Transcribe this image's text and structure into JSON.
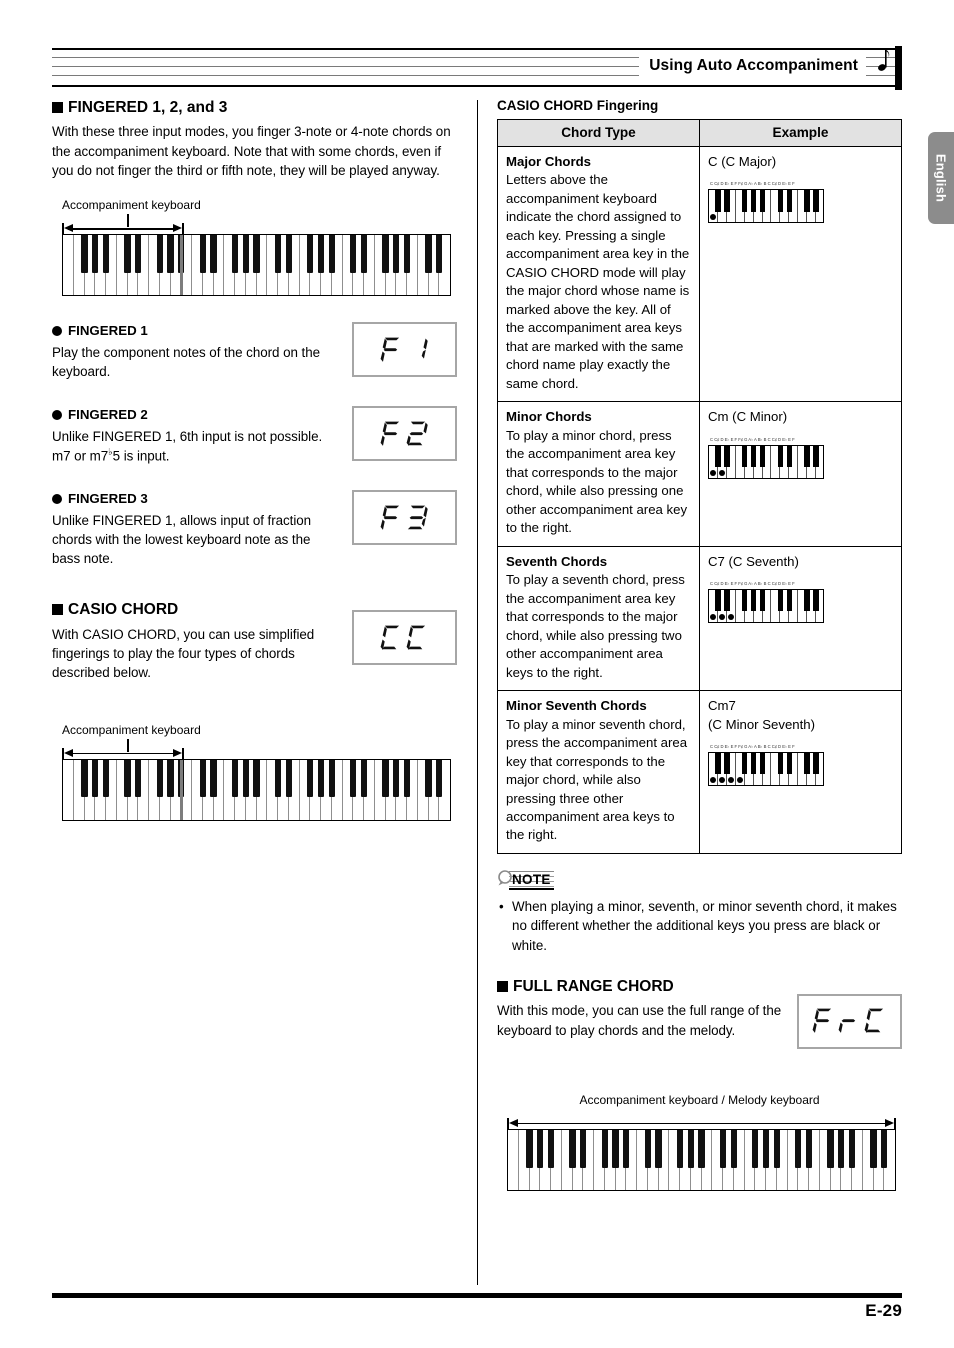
{
  "header": {
    "title": "Using Auto Accompaniment",
    "note_icon": "eighth-note-icon"
  },
  "language_tab": {
    "label": "English"
  },
  "footer": {
    "page_number": "E-29"
  },
  "left_column": {
    "fingered_section": {
      "heading": "FINGERED 1, 2, and 3",
      "body": "With these three input modes, you finger 3-note or 4-note chords on the accompaniment keyboard. Note that with some chords, even if you do not finger the third or fifth note, they will be played anyway.",
      "keyboard_caption": "Accompaniment keyboard"
    },
    "modes": [
      {
        "heading": "FINGERED 1",
        "body": "Play the component notes of the chord on the keyboard.",
        "display": "F1"
      },
      {
        "heading": "FINGERED 2",
        "body_pre": "Unlike FINGERED 1, 6th input is not possible. m7 or m7",
        "body_flat": "♭",
        "body_post": "5 is input.",
        "display": "F2"
      },
      {
        "heading": "FINGERED 3",
        "body": "Unlike FINGERED 1, allows input of fraction chords with the lowest keyboard note as the bass note.",
        "display": "F3"
      }
    ],
    "casio_chord_section": {
      "heading": "CASIO CHORD",
      "body": "With CASIO CHORD, you can use simplified fingerings to play the four types of chords described below.",
      "display": "CC",
      "keyboard_caption": "Accompaniment keyboard"
    }
  },
  "right_column": {
    "table_title": "CASIO CHORD Fingering",
    "table": {
      "columns": [
        "Chord Type",
        "Example"
      ],
      "rows": [
        {
          "name": "Major Chords",
          "description": "Letters above the accompaniment keyboard indicate the chord assigned to each key. Pressing a single accompaniment area key in the CASIO CHORD mode will play the major chord whose name is marked above the key. All of the accompaniment area keys that are marked with the same chord name play exactly the same chord.",
          "example_label": "C (C Major)",
          "example_label_2": "",
          "pressed_keys": 1,
          "key_labels": "C C♯ D E♭ E F F♯ G A♭ A B♭ B  C C♯ D E♭ E F"
        },
        {
          "name": "Minor Chords",
          "description": "To play a minor chord, press the accompaniment area key that corresponds to the major chord, while also pressing one other accompaniment area key to the right.",
          "example_label": "Cm (C Minor)",
          "example_label_2": "",
          "pressed_keys": 2,
          "key_labels": "C C♯ D E♭ E F F♯ G A♭ A B♭ B  C C♯ D E♭ E F"
        },
        {
          "name": "Seventh Chords",
          "description": "To play a seventh chord, press the accompaniment area key that corresponds to the major chord, while also pressing two other accompaniment area keys to the right.",
          "example_label": "C7 (C Seventh)",
          "example_label_2": "",
          "pressed_keys": 3,
          "key_labels": "C C♯ D E♭ E F F♯ G A♭ A B♭ B  C C♯ D E♭ E F"
        },
        {
          "name": "Minor Seventh Chords",
          "description": "To play a minor seventh chord, press the accompaniment area key that corresponds to the major chord, while also pressing three other accompaniment area keys to the right.",
          "example_label": "Cm7",
          "example_label_2": "(C Minor Seventh)",
          "pressed_keys": 4,
          "key_labels": "C C♯ D E♭ E F F♯ G A♭ A B♭ B  C C♯ D E♭ E F"
        }
      ]
    },
    "note_box": {
      "label": "NOTE",
      "items": [
        "When playing a minor, seventh, or minor seventh chord, it makes no different whether the additional keys you press are black or white."
      ]
    },
    "full_range_section": {
      "heading": "FULL RANGE CHORD",
      "body": "With this mode, you can use the full range of the keyboard to play chords and the melody.",
      "display": "FrC",
      "keyboard_caption": "Accompaniment keyboard / Melody keyboard"
    }
  }
}
